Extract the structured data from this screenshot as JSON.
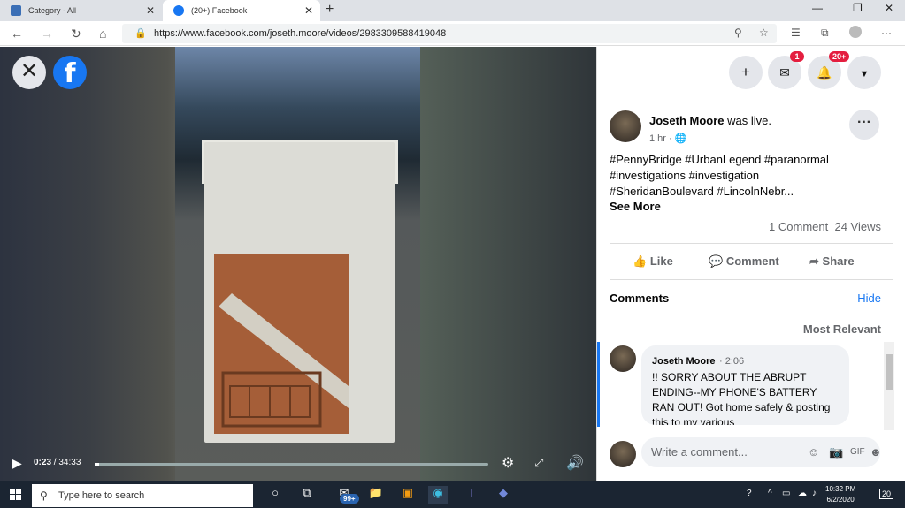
{
  "browser": {
    "tabs": [
      {
        "title": "Category - All"
      },
      {
        "title": "(20+) Facebook"
      }
    ],
    "url": "https://www.facebook.com/joseth.moore/videos/2983309588419048"
  },
  "video": {
    "current_time": "0:23",
    "duration": "34:33",
    "progress_fraction": 0.011
  },
  "topbar": {
    "messenger_badge": "1",
    "notifications_badge": "20+"
  },
  "post": {
    "author": "Joseth Moore",
    "status": "was live.",
    "time": "1 hr",
    "text_line1": "#PennyBridge #UrbanLegend #paranormal",
    "text_line2": "#investigations #investigation",
    "text_line3": "#SheridanBoulevard #LincolnNebr...",
    "see_more": "See More",
    "comments_count": "1 Comment",
    "views": "24 Views",
    "like": "Like",
    "comment": "Comment",
    "share": "Share"
  },
  "comments": {
    "header": "Comments",
    "hide": "Hide",
    "sort": "Most Relevant",
    "items": [
      {
        "author": "Joseth Moore",
        "time": "2:06",
        "text": "!! SORRY ABOUT THE ABRUPT ENDING--MY PHONE'S BATTERY RAN OUT! Got home safely & posting this to my various"
      }
    ],
    "placeholder": "Write a comment..."
  },
  "taskbar": {
    "search_placeholder": "Type here to search",
    "mail_badge": "99+",
    "time": "10:32 PM",
    "date": "6/2/2020",
    "notif_count": "20"
  }
}
